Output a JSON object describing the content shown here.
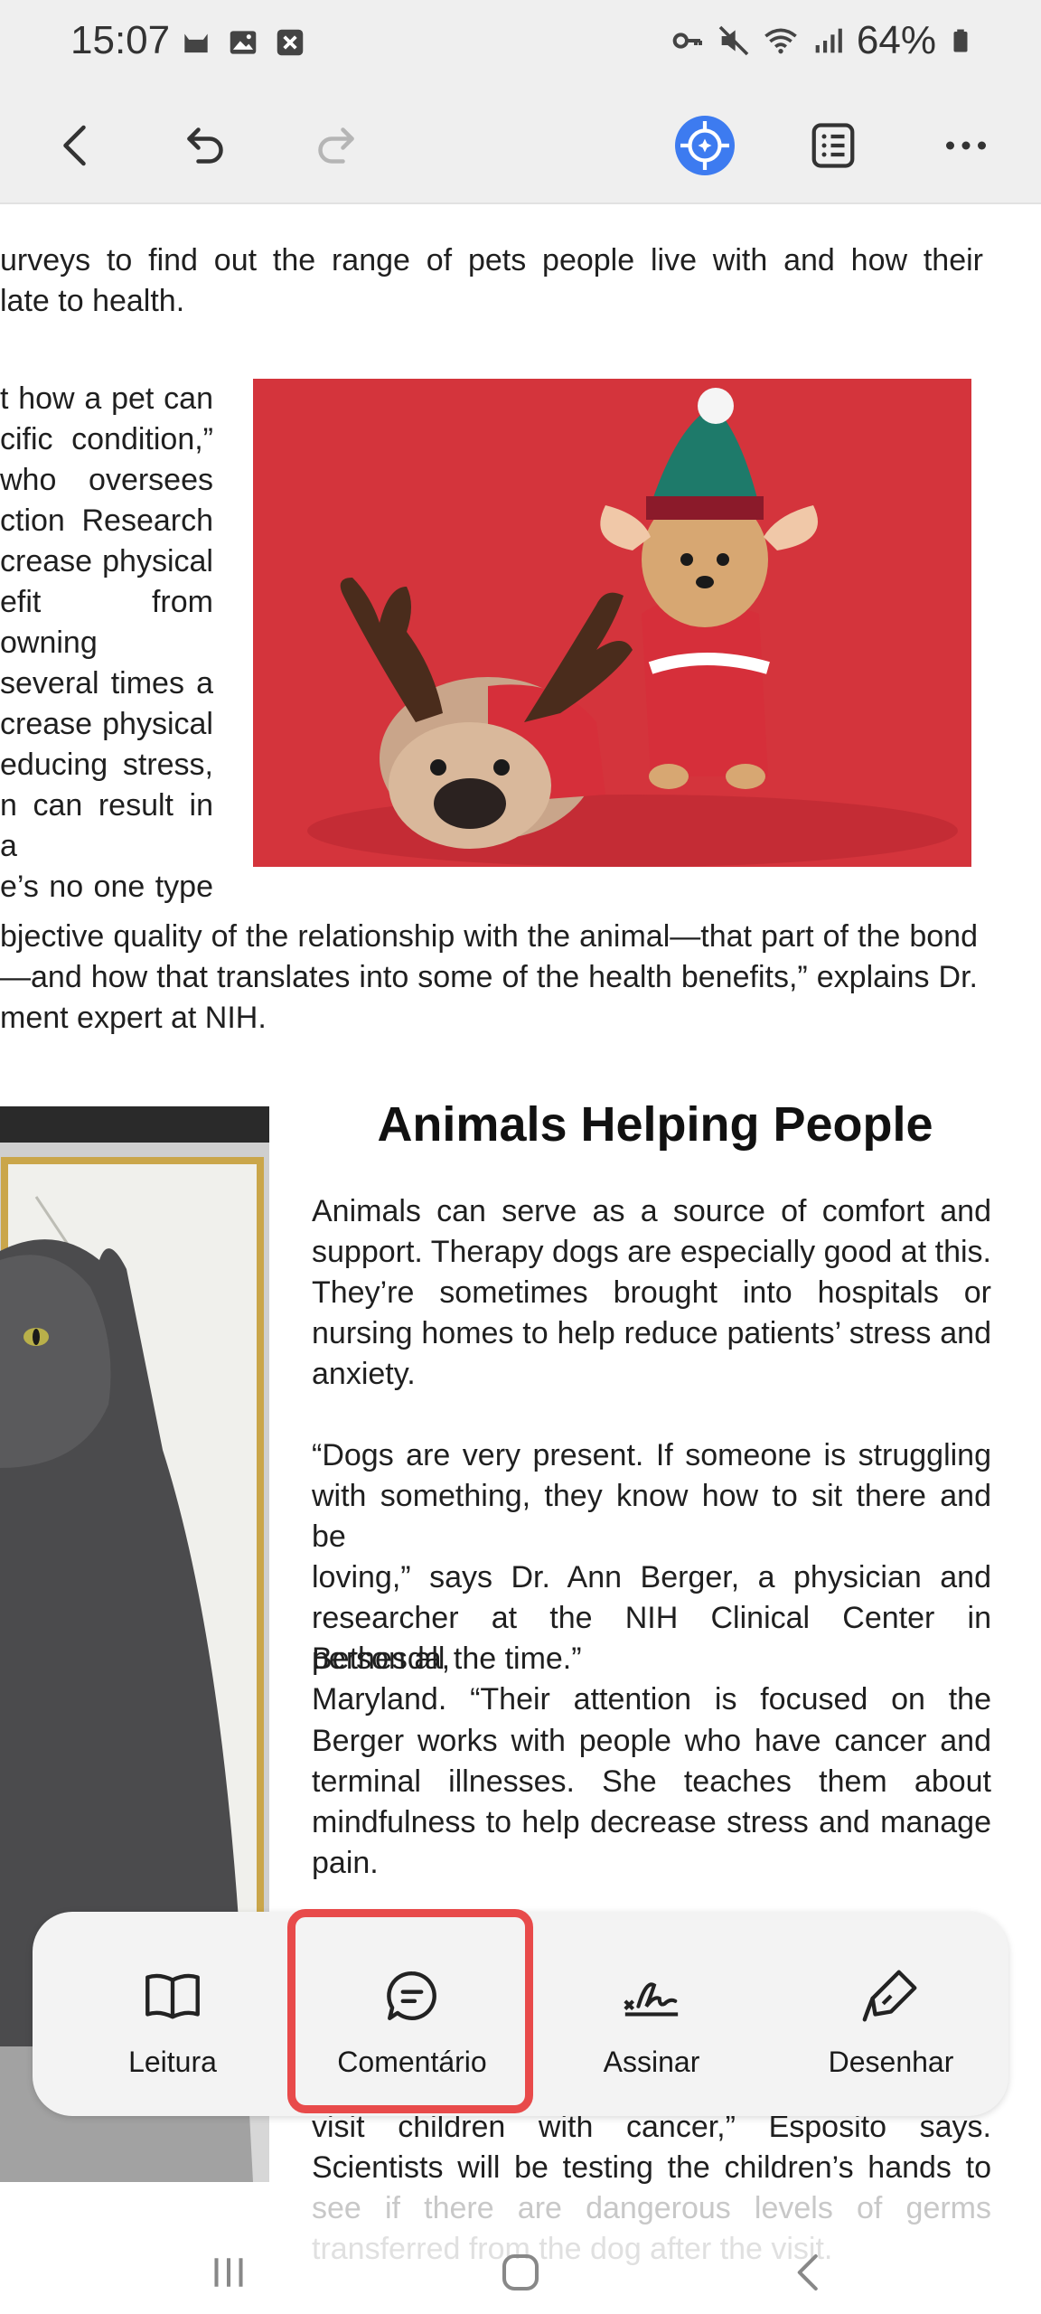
{
  "status_bar": {
    "time": "15:07",
    "battery": "64%"
  },
  "toolbar": {
    "icons": [
      "back-icon",
      "undo-icon",
      "redo-icon",
      "ai-assistant-icon",
      "toc-icon",
      "more-icon"
    ]
  },
  "document": {
    "p1": [
      "urveys to find out the range of pets people live with and how their",
      "late to health."
    ],
    "p2": [
      "t how a pet can",
      "cific condition,”",
      "who oversees",
      "ction Research",
      "crease physical",
      "efit from owning",
      "several times a",
      "crease physical",
      "educing stress,",
      "n can result in a",
      "e’s no one type"
    ],
    "p3": [
      "bjective quality of the relationship with the animal—that part of the bond",
      "—and how that translates into some of the health benefits,” explains Dr.",
      "ment expert at NIH."
    ],
    "heading": "Animals Helping People",
    "p4": [
      "Animals can serve as a source of comfort and",
      "support. Therapy dogs are especially good at this.",
      "They’re sometimes brought into hospitals or",
      "nursing homes to help reduce patients’ stress and",
      "anxiety."
    ],
    "p5": [
      "“Dogs are very present. If someone is struggling",
      "with something, they know how to sit there and be",
      "loving,” says Dr. Ann Berger, a physician and",
      "researcher at the NIH Clinical Center in Bethesda,",
      "Maryland. “Their attention is focused on the",
      "person all the time.”"
    ],
    "p6": [
      "Berger works with people who have cancer and",
      "terminal illnesses. She teaches them about",
      "mindfulness to help decrease stress and manage",
      "pain."
    ],
    "p7": [
      "visit children with cancer,” Esposito says.",
      "Scientists will be testing the children’s hands to",
      "see if there are dangerous levels of germs",
      "transferred from the dog after the visit."
    ]
  },
  "actions": [
    {
      "label": "Leitura",
      "icon": "book-icon"
    },
    {
      "label": "Comentário",
      "icon": "comment-icon"
    },
    {
      "label": "Assinar",
      "icon": "signature-icon"
    },
    {
      "label": "Desenhar",
      "icon": "pen-icon"
    }
  ],
  "colors": {
    "highlight": "#e84a4a",
    "toolbar_bg": "#efefef",
    "ai_icon": "#3d7bf0"
  }
}
